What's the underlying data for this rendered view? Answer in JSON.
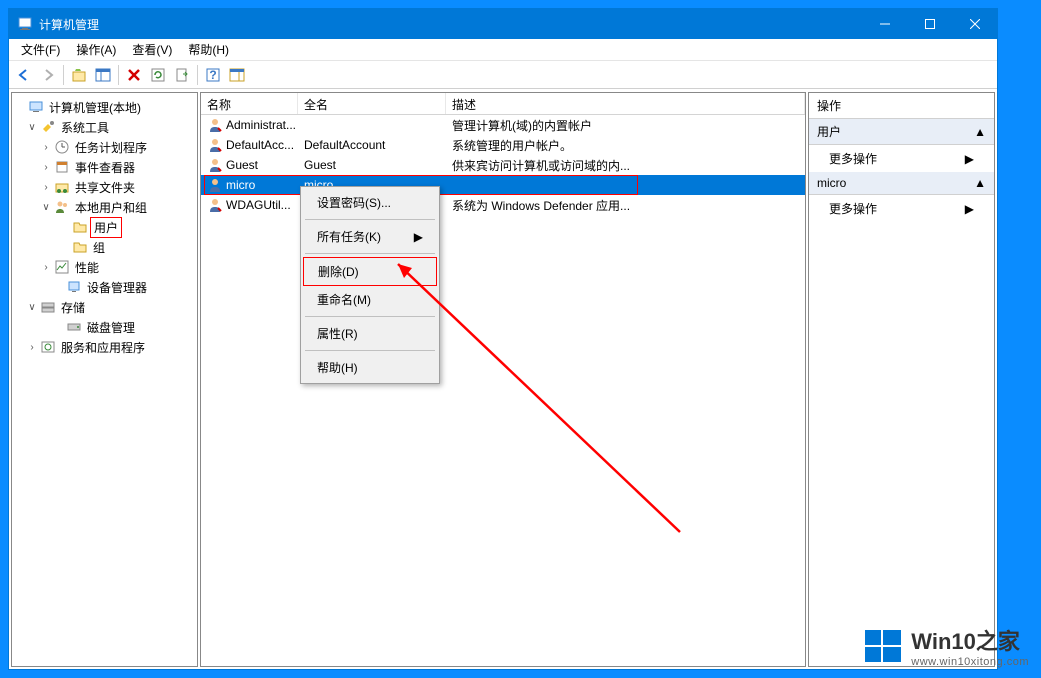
{
  "title": "计算机管理",
  "menu": {
    "file": "文件(F)",
    "action": "操作(A)",
    "view": "查看(V)",
    "help": "帮助(H)"
  },
  "tree": {
    "root": "计算机管理(本地)",
    "sysTools": "系统工具",
    "taskSched": "任务计划程序",
    "eventViewer": "事件查看器",
    "sharedFolders": "共享文件夹",
    "localUsers": "本地用户和组",
    "users": "用户",
    "groups": "组",
    "perf": "性能",
    "devmgr": "设备管理器",
    "storage": "存储",
    "diskmgr": "磁盘管理",
    "services": "服务和应用程序"
  },
  "columns": {
    "name": "名称",
    "fullname": "全名",
    "desc": "描述"
  },
  "rows": [
    {
      "name": "Administrat...",
      "full": "",
      "desc": "管理计算机(域)的内置帐户"
    },
    {
      "name": "DefaultAcc...",
      "full": "DefaultAccount",
      "desc": "系统管理的用户帐户。"
    },
    {
      "name": "Guest",
      "full": "Guest",
      "desc": "供来宾访问计算机或访问域的内..."
    },
    {
      "name": "micro",
      "full": "micro",
      "desc": ""
    },
    {
      "name": "WDAGUtil...",
      "full": "",
      "desc": "系统为 Windows Defender 应用..."
    }
  ],
  "ctx": {
    "setpwd": "设置密码(S)...",
    "alltasks": "所有任务(K)",
    "delete": "删除(D)",
    "rename": "重命名(M)",
    "props": "属性(R)",
    "help": "帮助(H)"
  },
  "actions": {
    "header": "操作",
    "sec1": "用户",
    "more": "更多操作",
    "sec2": "micro"
  },
  "watermark": {
    "title": "Win10之家",
    "url": "www.win10xitong.com"
  }
}
